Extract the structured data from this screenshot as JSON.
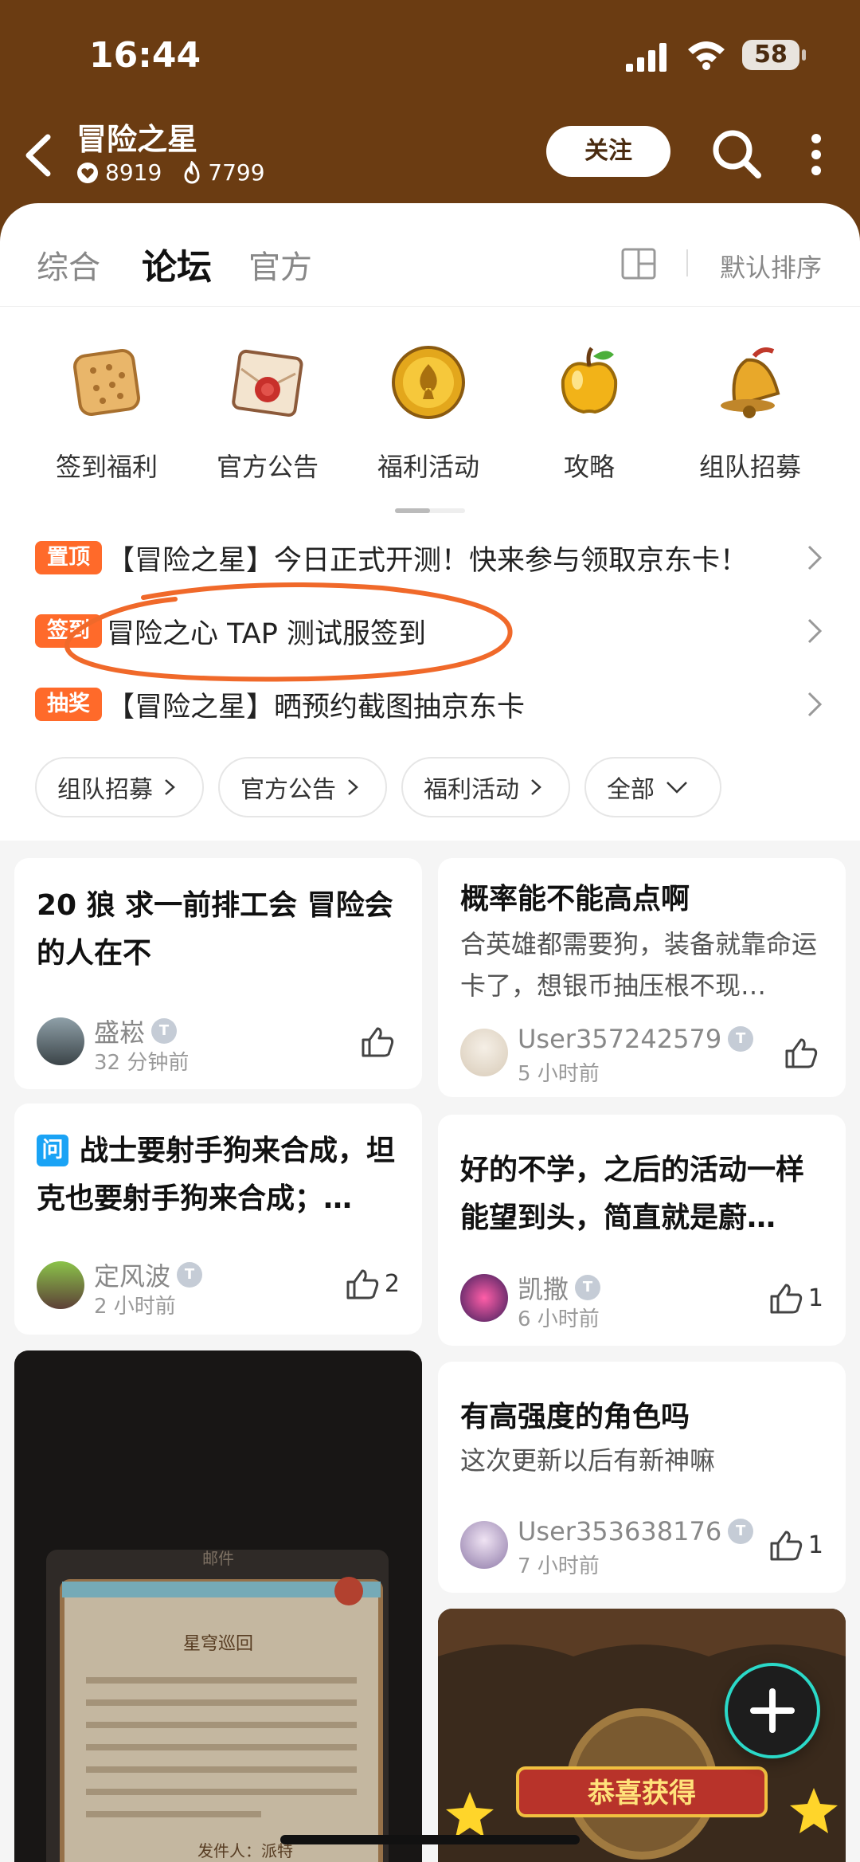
{
  "status_bar": {
    "time": "16:44",
    "battery": "58"
  },
  "header": {
    "title": "冒险之星",
    "likes": "8919",
    "fans": "7799",
    "follow_label": "关注"
  },
  "tabs": [
    {
      "label": "综合"
    },
    {
      "label": "论坛"
    },
    {
      "label": "官方"
    }
  ],
  "sort_label": "默认排序",
  "categories": [
    {
      "label": "签到福利",
      "icon": "biscuit-icon"
    },
    {
      "label": "官方公告",
      "icon": "letter-seal-icon"
    },
    {
      "label": "福利活动",
      "icon": "gold-coin-icon"
    },
    {
      "label": "攻略",
      "icon": "golden-apple-icon"
    },
    {
      "label": "组队招募",
      "icon": "bell-icon"
    }
  ],
  "notices": [
    {
      "badge": "置顶",
      "text": "【冒险之星】今日正式开测！快来参与领取京东卡！"
    },
    {
      "badge": "签到",
      "text": "冒险之心 TAP 测试服签到"
    },
    {
      "badge": "抽奖",
      "text": "【冒险之星】晒预约截图抽京东卡"
    }
  ],
  "filter_chips": [
    {
      "label": "组队招募"
    },
    {
      "label": "官方公告"
    },
    {
      "label": "福利活动"
    },
    {
      "label": "全部"
    }
  ],
  "posts": [
    {
      "title": "20 狼 求一前排工会 冒险会的人在不",
      "user": "盛崧",
      "time": "32 分钟前",
      "likes": ""
    },
    {
      "title": "概率能不能高点啊",
      "summary": "合英雄都需要狗，装备就靠命运卡了，想银币抽压根不现…",
      "user": "User357242579",
      "time": "5 小时前",
      "likes": ""
    },
    {
      "qtag": "问",
      "title": "战士要射手狗来合成，坦克也要射手狗来合成；…",
      "user": "定风波",
      "time": "2 小时前",
      "likes": "2"
    },
    {
      "title": "好的不学，之后的活动一样能望到头，简直就是蔚…",
      "user": "凯撒",
      "time": "6 小时前",
      "likes": "1"
    },
    {
      "title": "有高强度的角色吗",
      "summary": "这次更新以后有新神嘛",
      "user": "User353638176",
      "time": "7 小时前",
      "likes": "1"
    }
  ],
  "image_post_left": {
    "header": "邮件",
    "title": "星穹巡回",
    "sender": "发件人：派特"
  },
  "image_post_right": {
    "banner": "恭喜获得"
  },
  "tbadge_label": "T",
  "colors": {
    "header_bg": "#6b3c12",
    "accent": "#16c5b2",
    "notice_badge": "#ff6a2a",
    "question_badge": "#1aa3f5"
  }
}
